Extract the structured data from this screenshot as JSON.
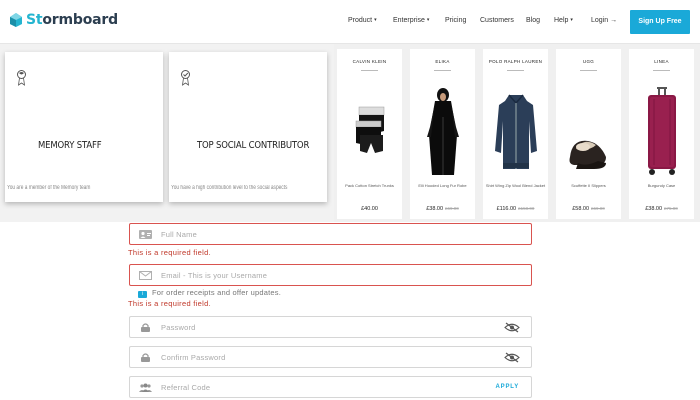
{
  "header": {
    "logo_prefix": "St",
    "logo_rest": "ormboard",
    "nav": [
      {
        "label": "Product",
        "dropdown": true
      },
      {
        "label": "Enterprise",
        "dropdown": true
      },
      {
        "label": "Pricing",
        "dropdown": false
      },
      {
        "label": "Customers",
        "dropdown": false
      },
      {
        "label": "Blog",
        "dropdown": false
      },
      {
        "label": "Help",
        "dropdown": true
      }
    ],
    "login_label": "Login →",
    "signup_label": "Sign Up Free",
    "caret": "▾",
    "brand_color": "#1aa9d8"
  },
  "cards": [
    {
      "title": "MEMORY STAFF",
      "description": "You are a member of the Memory team"
    },
    {
      "title": "TOP SOCIAL CONTRIBUTOR",
      "description": "You have a high contribution level to the social aspects"
    }
  ],
  "products": [
    {
      "brand": "CALVIN KLEIN",
      "name": "Pack Cotton Stretch Trunks",
      "price": "£40.00",
      "old_price": ""
    },
    {
      "brand": "ELIKA",
      "name": "Elli Hooded Long Fur Robe",
      "price": "£38.00",
      "old_price": "£69.00"
    },
    {
      "brand": "POLO RALPH LAUREN",
      "name": "Shirt Wing Zip Wool Blend Jacket",
      "price": "£116.00",
      "old_price": "£158.00"
    },
    {
      "brand": "UGG",
      "name": "Scuffette II Slippers",
      "price": "£58.00",
      "old_price": "£69.00"
    },
    {
      "brand": "LINEA",
      "name": "Burgundy Case",
      "price": "£38.00",
      "old_price": "£75.00"
    }
  ],
  "form": {
    "full_name_placeholder": "Full Name",
    "full_name_error": "This is a required field.",
    "email_placeholder": "Email - This is your Username",
    "email_info": "For order receipts and offer updates.",
    "email_error": "This is a required field.",
    "password_placeholder": "Password",
    "confirm_placeholder": "Confirm Password",
    "referral_placeholder": "Referral Code",
    "apply_label": "APPLY",
    "info_badge": "i",
    "error_color": "#d9534f"
  }
}
